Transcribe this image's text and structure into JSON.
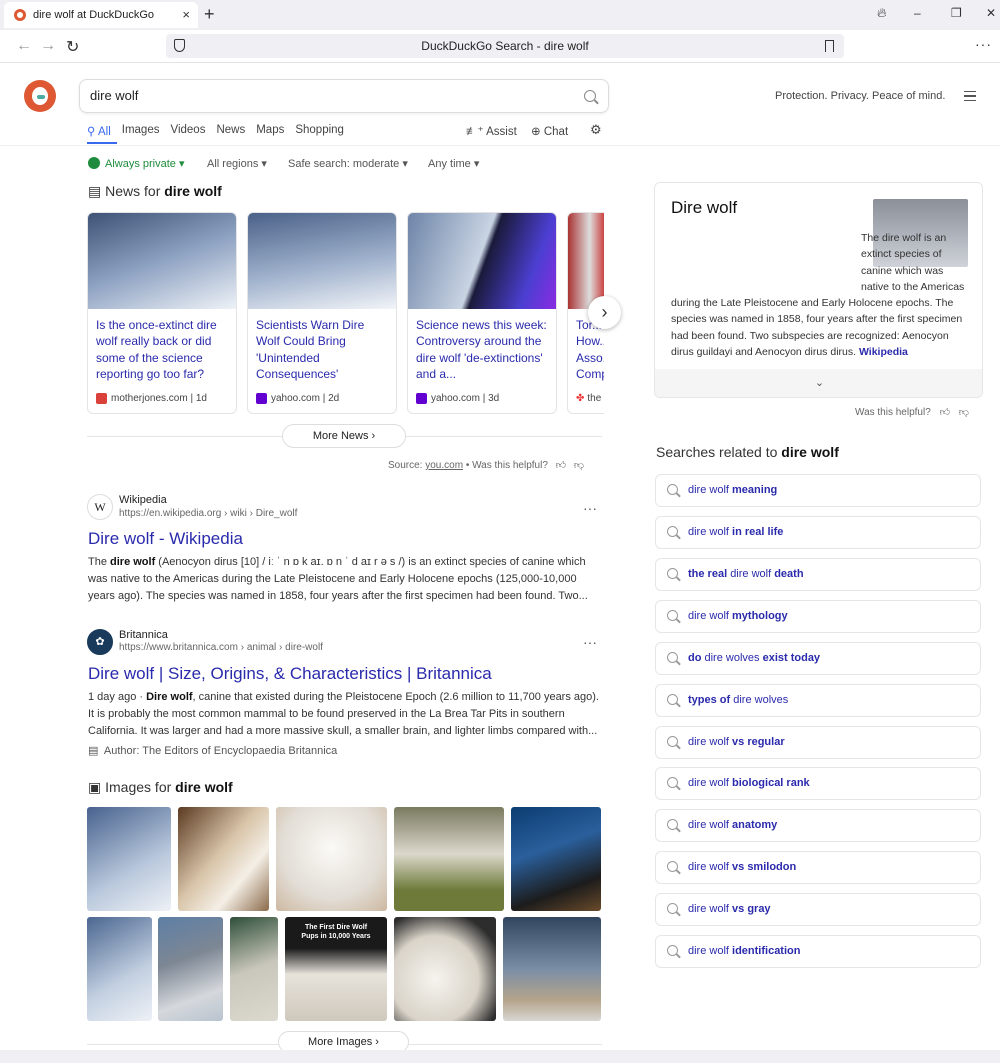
{
  "browser": {
    "tab_title": "dire wolf at DuckDuckGo",
    "tab_close": "×",
    "new_tab": "+",
    "address": "DuckDuckGo Search - dire wolf",
    "win_min": "–",
    "win_max": "❐",
    "win_close": "✕",
    "menu": "···"
  },
  "header": {
    "query": "dire wolf",
    "tagline": "Protection. Privacy. Peace of mind."
  },
  "tabs": {
    "all": "All",
    "images": "Images",
    "videos": "Videos",
    "news": "News",
    "maps": "Maps",
    "shopping": "Shopping",
    "assist": "Assist",
    "chat": "Chat"
  },
  "filters": {
    "private": "Always private ▾",
    "regions": "All regions ▾",
    "safe": "Safe search: moderate ▾",
    "time": "Any time ▾"
  },
  "news": {
    "heading_prefix": "News for ",
    "heading_query": "dire wolf",
    "cards": [
      {
        "title": "Is the once-extinct dire wolf really back or did some of the science reporting go too far?",
        "source": "motherjones.com",
        "age": "1d",
        "color": "#d9413a"
      },
      {
        "title": "Scientists Warn Dire Wolf Could Bring 'Unintended Consequences'",
        "source": "yahoo.com",
        "age": "2d",
        "color": "#6001d2"
      },
      {
        "title": "Science news this week: Controversy around the dire wolf 'de-extinctions' and a...",
        "source": "yahoo.com",
        "age": "3d",
        "color": "#6001d2"
      },
      {
        "title": "Tor... How... Asso... Comp...",
        "source": "the",
        "age": "",
        "color": "#e33"
      }
    ],
    "more": "More News ›",
    "source_label": "Source:",
    "source_link": "you.com",
    "helpful": "• Was this helpful?"
  },
  "results": [
    {
      "site": "Wikipedia",
      "url": "https://en.wikipedia.org › wiki › Dire_wolf",
      "title": "Dire wolf - Wikipedia",
      "snippet_pre": "The ",
      "snippet_bold": "dire wolf",
      "snippet_post": " (Aenocyon dirus [10] / iː ˈ n ɒ k aɪ. ɒ n ˈ d aɪ r ə s /) is an extinct species of canine which was native to the Americas during the Late Pleistocene and Early Holocene epochs (125,000-10,000 years ago). The species was named in 1858, four years after the first specimen had been found. Two..."
    },
    {
      "site": "Britannica",
      "url": "https://www.britannica.com › animal › dire-wolf",
      "title": "Dire wolf | Size, Origins, & Characteristics | Britannica",
      "snippet_pre": "1 day ago · ",
      "snippet_bold": "Dire wolf",
      "snippet_post": ", canine that existed during the Pleistocene Epoch (2.6 million to 11,700 years ago). It is probably the most common mammal to be found preserved in the La Brea Tar Pits in southern California. It was larger and had a more massive skull, a smaller brain, and lighter limbs compared with...",
      "author_label": "Author:",
      "author": "The Editors of Encyclopaedia Britannica"
    }
  ],
  "images": {
    "heading_prefix": "Images for ",
    "heading_query": "dire wolf",
    "more": "More Images ›",
    "overlay_line1": "The First Dire Wolf",
    "overlay_line2": "Pups in 10,000 Years"
  },
  "knowledge": {
    "title": "Dire wolf",
    "text": "The dire wolf is an extinct species of canine which was native to the Americas during the Late Pleistocene and Early Holocene epochs. The species was named in 1858, four years after the first specimen had been found. Two subspecies are recognized: Aenocyon dirus guildayi and Aenocyon dirus dirus.",
    "link": "Wikipedia",
    "expand": "⌄",
    "helpful": "Was this helpful?"
  },
  "related": {
    "heading_prefix": "Searches related to ",
    "heading_query": "dire wolf",
    "items": [
      {
        "a": "dire wolf",
        "b": " meaning"
      },
      {
        "a": "dire wolf",
        "b": " in real life"
      },
      {
        "a": "the real ",
        "b": "dire wolf",
        "c": " death"
      },
      {
        "a": "dire wolf",
        "b": " mythology"
      },
      {
        "a": "do ",
        "b": "dire wolves",
        "c": " exist today"
      },
      {
        "a": "types of ",
        "b": "dire wolves"
      },
      {
        "a": "dire wolf",
        "b": " vs regular"
      },
      {
        "a": "dire wolf",
        "b": " biological rank"
      },
      {
        "a": "dire wolf",
        "b": " anatomy"
      },
      {
        "a": "dire wolf",
        "b": " vs smilodon"
      },
      {
        "a": "dire wolf",
        "b": " vs gray"
      },
      {
        "a": "dire wolf",
        "b": " identification"
      }
    ]
  },
  "colors": {
    "accent": "#3969ef",
    "link": "#2a2aac",
    "brand": "#de5833",
    "private_green": "#1e8c3c"
  }
}
